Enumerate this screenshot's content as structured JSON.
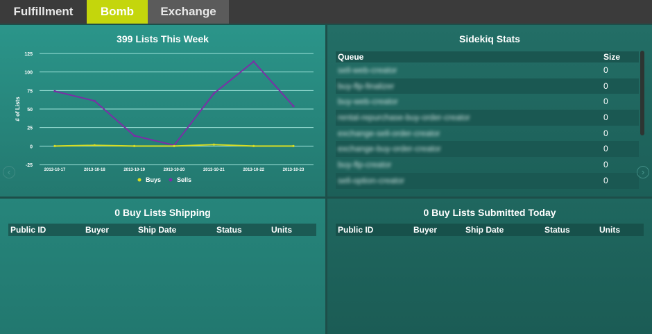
{
  "tabs": [
    {
      "label": "Fulfillment"
    },
    {
      "label": "Bomb",
      "active": true
    },
    {
      "label": "Exchange"
    }
  ],
  "colors": {
    "accent": "#c4d60c",
    "buys": "#d6dc24",
    "sells": "#7a2fa6"
  },
  "lists_panel": {
    "title": "399 Lists This Week",
    "chart_data": {
      "type": "line",
      "title": "399 Lists This Week",
      "xlabel": "",
      "ylabel": "# of Lists",
      "categories": [
        "2013-10-17",
        "2013-10-18",
        "2013-10-19",
        "2013-10-20",
        "2013-10-21",
        "2013-10-22",
        "2013-10-23"
      ],
      "yticks": [
        "125",
        "100",
        "75",
        "50",
        "25",
        "0",
        "-25"
      ],
      "ylim": [
        -25,
        125
      ],
      "grid": true,
      "legend": "bottom",
      "series": [
        {
          "name": "Buys",
          "values": [
            0,
            1,
            0,
            0,
            2,
            0,
            0
          ]
        },
        {
          "name": "Sells",
          "values": [
            74,
            61,
            14,
            1,
            71,
            114,
            54
          ]
        }
      ]
    }
  },
  "sidekiq": {
    "title": "Sidekiq Stats",
    "columns": {
      "queue": "Queue",
      "size": "Size"
    },
    "rows": [
      {
        "queue": "sell-web-creator",
        "size": "0"
      },
      {
        "queue": "buy-flp-finalizer",
        "size": "0"
      },
      {
        "queue": "buy-web-creator",
        "size": "0"
      },
      {
        "queue": "rental-repurchase-buy-order-creator",
        "size": "0"
      },
      {
        "queue": "exchange-sell-order-creator",
        "size": "0"
      },
      {
        "queue": "exchange-buy-order-creator",
        "size": "0"
      },
      {
        "queue": "buy-flp-creator",
        "size": "0"
      },
      {
        "queue": "sell-option-creator",
        "size": "0"
      }
    ]
  },
  "shipping": {
    "title": "0 Buy Lists Shipping",
    "columns": [
      "Public ID",
      "Buyer",
      "Ship Date",
      "Status",
      "Units"
    ]
  },
  "submitted": {
    "title": "0 Buy Lists Submitted Today",
    "columns": [
      "Public ID",
      "Buyer",
      "Ship Date",
      "Status",
      "Units"
    ]
  },
  "nav": {
    "prev_icon": "chevron-left-icon",
    "next_icon": "chevron-right-icon"
  }
}
